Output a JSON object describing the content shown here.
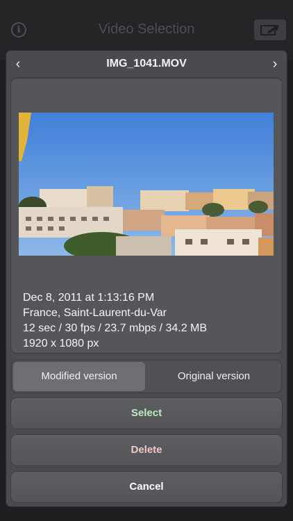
{
  "topbar": {
    "title": "Video Selection",
    "info_icon": "info-circle-icon",
    "export_icon": "share-export-icon"
  },
  "panel": {
    "file_name": "IMG_1041.MOV",
    "prev_icon": "chevron-left-icon",
    "next_icon": "chevron-right-icon",
    "metadata": {
      "date": "Dec 8, 2011 at 1:13:16 PM",
      "location": "France, Saint-Laurent-du-Var",
      "specs": "12 sec / 30 fps / 23.7 mbps / 34.2 MB",
      "resolution": "1920 x 1080 px"
    }
  },
  "version_toggle": {
    "options": [
      "Modified version",
      "Original version"
    ],
    "selected": "Modified version"
  },
  "actions": {
    "select_label": "Select",
    "delete_label": "Delete",
    "cancel_label": "Cancel"
  },
  "colors": {
    "select_text": "#bcebc0",
    "delete_text": "#f2c6c6",
    "background": "#1e1f21"
  }
}
